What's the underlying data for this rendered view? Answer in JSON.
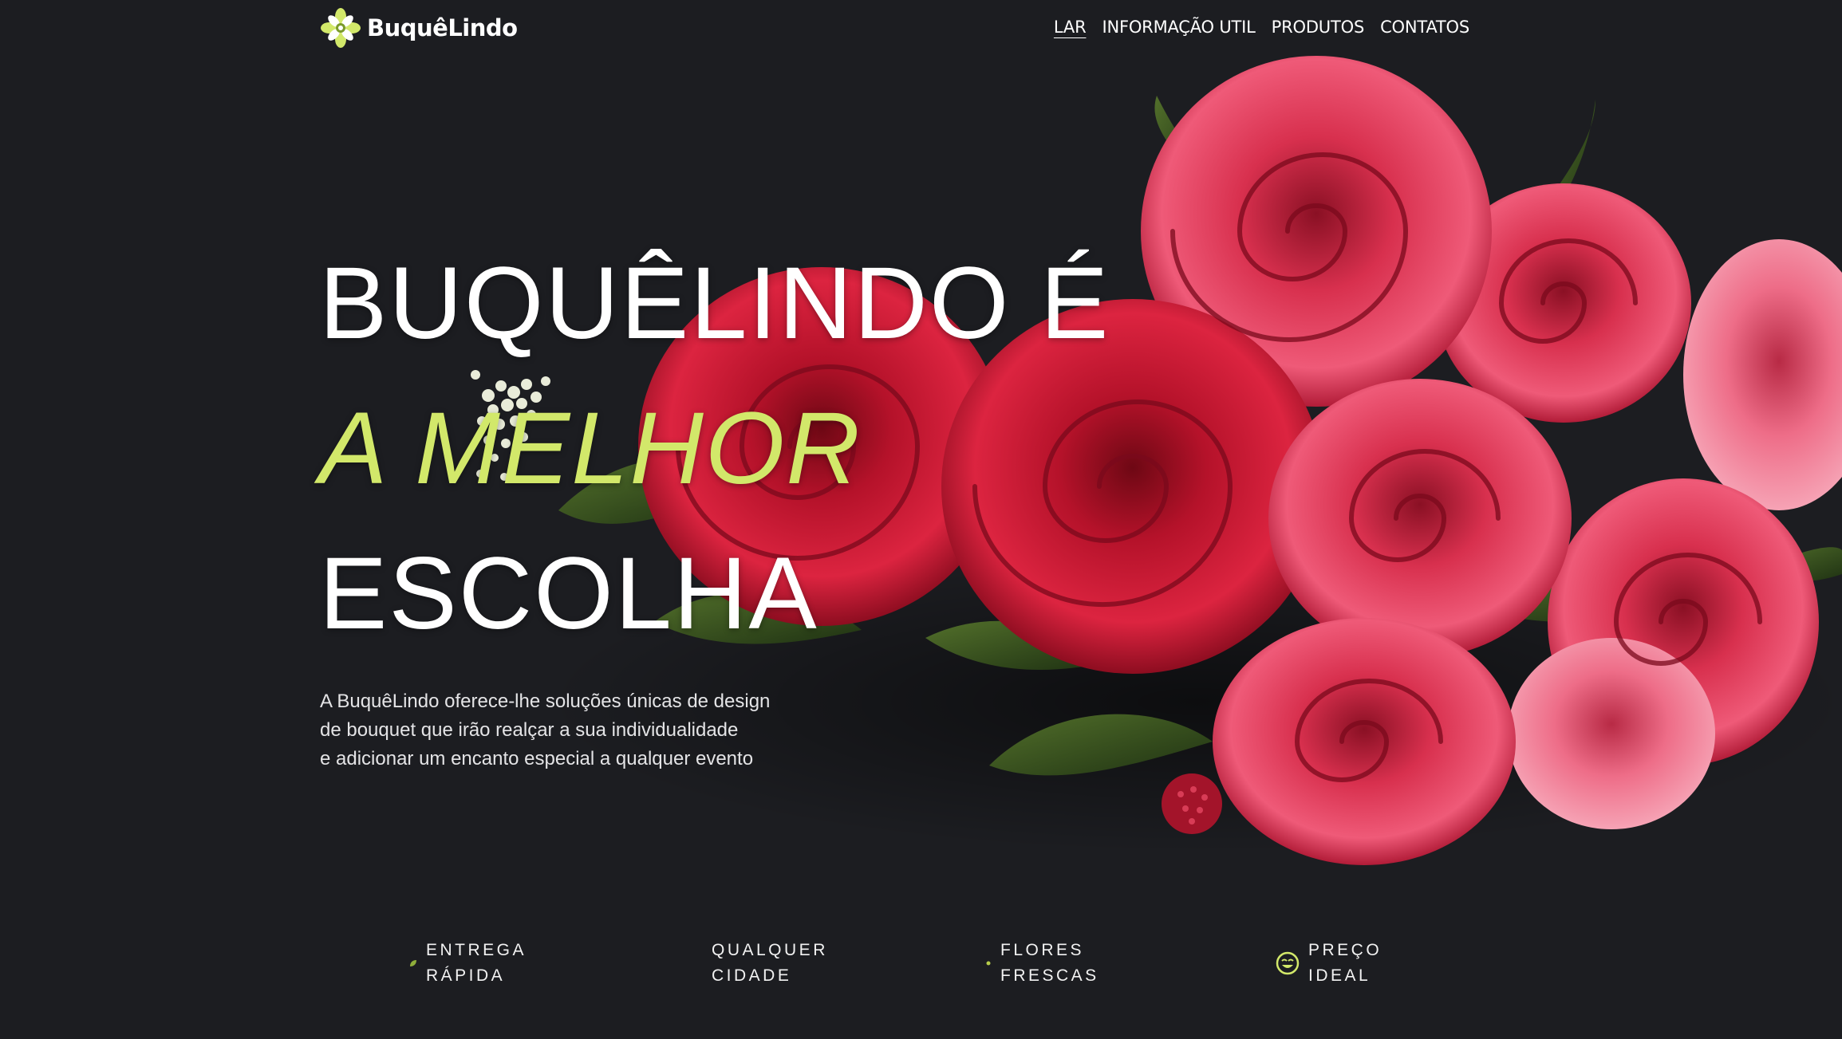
{
  "brand": {
    "name": "BuquêLindo",
    "logo_icon": "flower-logo-icon",
    "accent_color": "#d2e86a",
    "background_color": "#1c1d21"
  },
  "nav": {
    "items": [
      {
        "label": "LAR",
        "active": true
      },
      {
        "label": "INFORMAÇÃO UTIL",
        "active": false
      },
      {
        "label": "PRODUTOS",
        "active": false
      },
      {
        "label": "CONTATOS",
        "active": false
      }
    ]
  },
  "hero": {
    "line1": "BUQUÊLINDO É",
    "line2": "A MELHOR",
    "line3": "ESCOLHA",
    "description": [
      "A BuquêLindo oferece-lhe soluções únicas de design",
      "de bouquet que irão realçar a sua individualidade",
      "e adicionar um encanto especial a qualquer evento"
    ],
    "image": "red-roses-bouquet"
  },
  "features": [
    {
      "icon": "leaf-icon",
      "line1": "ENTREGA",
      "line2": "RÁPIDA"
    },
    {
      "icon": "city-icon",
      "line1": "QUALQUER",
      "line2": "CIDADE"
    },
    {
      "icon": "sprout-icon",
      "line1": "FLORES",
      "line2": "FRESCAS"
    },
    {
      "icon": "smile-icon",
      "line1": "PREÇO",
      "line2": "IDEAL"
    }
  ]
}
